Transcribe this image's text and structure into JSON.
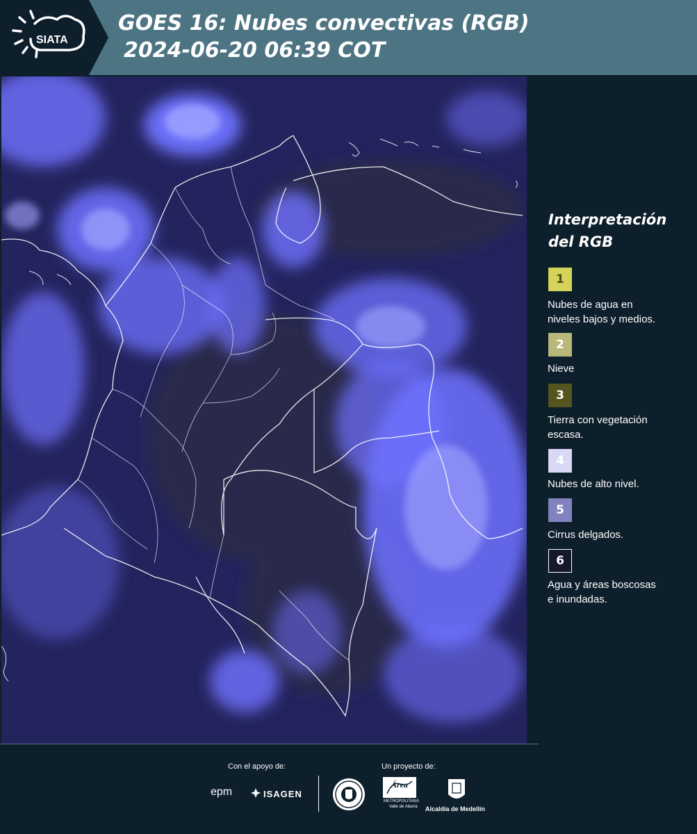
{
  "header": {
    "logo_text": "SIATA",
    "title_line1": "GOES 16: Nubes convectivas (RGB)",
    "title_line2": "2024-06-20 06:39 COT",
    "background_color": "#4d7483",
    "logo_background_color": "#0d1f2b"
  },
  "map": {
    "description_icon": "satellite-rgb-composite",
    "boundary_color": "#ffffff",
    "cloud_color": "#7b7cff",
    "background_color": "#1f2160"
  },
  "legend": {
    "title_line1": "Interpretación",
    "title_line2": "del RGB",
    "items": [
      {
        "number": "1",
        "label_line1": "Nubes de agua en",
        "label_line2": "niveles bajos y medios.",
        "color": "#d6d35a",
        "text_color": "#4a4a1a"
      },
      {
        "number": "2",
        "label_line1": "Nieve",
        "label_line2": "",
        "color": "#b9b77a",
        "text_color": "#ffffff"
      },
      {
        "number": "3",
        "label_line1": "Tierra con vegetación",
        "label_line2": "escasa.",
        "color": "#55551f",
        "text_color": "#ffffff"
      },
      {
        "number": "4",
        "label_line1": "Nubes de alto nivel.",
        "label_line2": "",
        "color": "#d9d9f5",
        "text_color": "#ffffff"
      },
      {
        "number": "5",
        "label_line1": "Cirrus delgados.",
        "label_line2": "",
        "color": "#8282c0",
        "text_color": "#ffffff"
      },
      {
        "number": "6",
        "label_line1": "Agua y áreas boscosas",
        "label_line2": "e inundadas.",
        "color": "#15172a",
        "text_color": "#ffffff"
      }
    ]
  },
  "footer": {
    "support_label": "Con el apoyo de:",
    "project_label": "Un proyecto de:",
    "sponsor_1": "epm",
    "sponsor_2": "ISAGEN",
    "area_name": "Área",
    "area_line1": "METROPOLITANA",
    "area_line2": "Valle de Aburrá",
    "alcaldia": "Alcaldía de Medellín"
  }
}
